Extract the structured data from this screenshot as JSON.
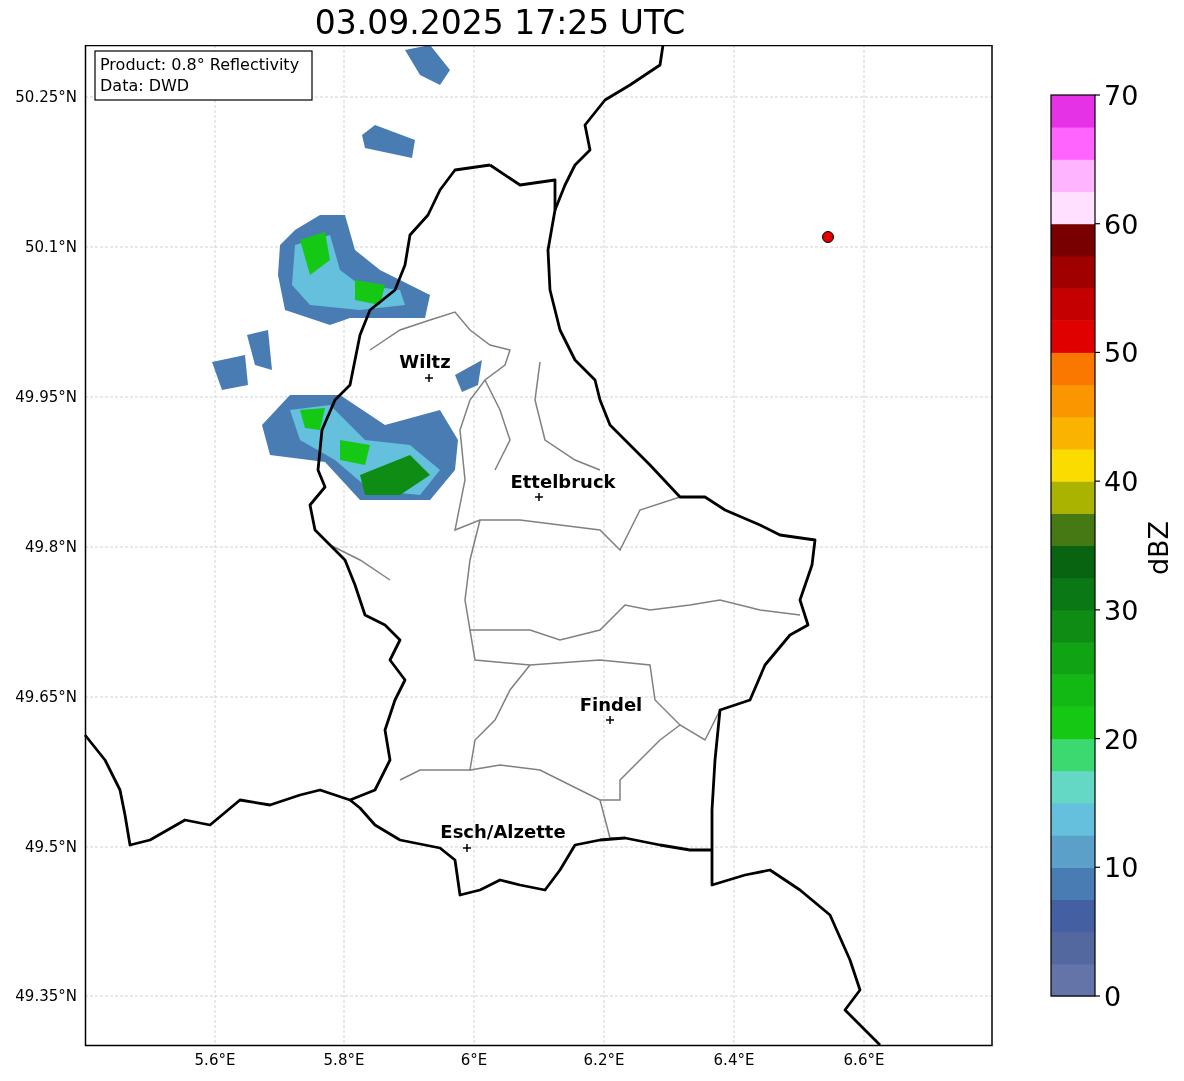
{
  "title": "03.09.2025 17:25 UTC",
  "info_box": [
    "Product: 0.8° Reflectivity",
    "Data: DWD"
  ],
  "y_ticks": [
    "50.25°N",
    "50.1°N",
    "49.95°N",
    "49.8°N",
    "49.65°N",
    "49.5°N",
    "49.35°N"
  ],
  "x_ticks": [
    "5.6°E",
    "5.8°E",
    "6°E",
    "6.2°E",
    "6.4°E",
    "6.6°E"
  ],
  "cities": [
    {
      "name": "Wiltz"
    },
    {
      "name": "Ettelbruck"
    },
    {
      "name": "Findel"
    },
    {
      "name": "Esch/Alzette"
    }
  ],
  "colorbar": {
    "label": "dBZ",
    "ticks": [
      "70",
      "60",
      "50",
      "40",
      "30",
      "20",
      "10",
      "0"
    ],
    "bins": [
      {
        "color": "#6474a8"
      },
      {
        "color": "#5468a0"
      },
      {
        "color": "#4460a2"
      },
      {
        "color": "#4a7cb4"
      },
      {
        "color": "#5aa0c8"
      },
      {
        "color": "#64c0dc"
      },
      {
        "color": "#64d8c4"
      },
      {
        "color": "#3cd870"
      },
      {
        "color": "#14c814"
      },
      {
        "color": "#12b814"
      },
      {
        "color": "#10a414"
      },
      {
        "color": "#0e8c14"
      },
      {
        "color": "#0a7814"
      },
      {
        "color": "#086410"
      },
      {
        "color": "#467814"
      },
      {
        "color": "#aab400"
      },
      {
        "color": "#fadc00"
      },
      {
        "color": "#fab400"
      },
      {
        "color": "#fa9600"
      },
      {
        "color": "#fa7800"
      },
      {
        "color": "#e10000"
      },
      {
        "color": "#c40000"
      },
      {
        "color": "#a00000"
      },
      {
        "color": "#780000"
      },
      {
        "color": "#ffe0ff"
      },
      {
        "color": "#ffb4ff"
      },
      {
        "color": "#ff64ff"
      },
      {
        "color": "#e632e6"
      }
    ]
  }
}
